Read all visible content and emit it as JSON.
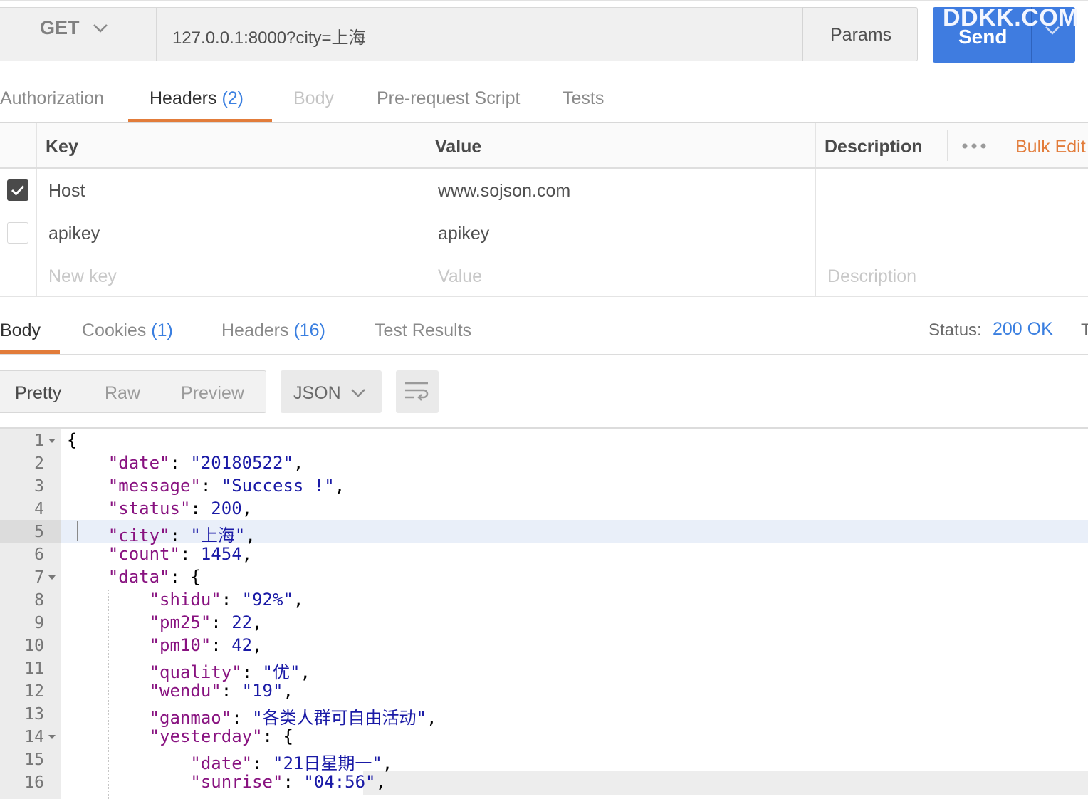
{
  "request": {
    "method": "GET",
    "url": "127.0.0.1:8000?city=上海",
    "params_label": "Params",
    "send_label": "Send",
    "watermark": "DDKK.COM"
  },
  "request_tabs": [
    {
      "label": "Authorization",
      "count": ""
    },
    {
      "label": "Headers",
      "count": "(2)"
    },
    {
      "label": "Body",
      "count": ""
    },
    {
      "label": "Pre-request Script",
      "count": ""
    },
    {
      "label": "Tests",
      "count": ""
    }
  ],
  "headers_table": {
    "columns": {
      "key": "Key",
      "value": "Value",
      "description": "Description"
    },
    "more_icon": "ellipsis-icon",
    "bulk_edit": "Bulk Edit",
    "rows": [
      {
        "checked": true,
        "key": "Host",
        "value": "www.sojson.com",
        "description": ""
      },
      {
        "checked": false,
        "key": "apikey",
        "value": "apikey",
        "description": ""
      }
    ],
    "placeholders": {
      "key": "New key",
      "value": "Value",
      "description": "Description"
    }
  },
  "response_tabs": [
    {
      "label": "Body",
      "count": ""
    },
    {
      "label": "Cookies",
      "count": "(1)"
    },
    {
      "label": "Headers",
      "count": "(16)"
    },
    {
      "label": "Test Results",
      "count": ""
    }
  ],
  "status": {
    "label": "Status:",
    "value": "200 OK",
    "status_color": "#3a7fe0",
    "trailing": "T"
  },
  "view": {
    "modes": [
      "Pretty",
      "Raw",
      "Preview"
    ],
    "active_mode": "Pretty",
    "format": "JSON",
    "wrap_icon": "wrap-lines-icon"
  },
  "code_lines": [
    {
      "n": "1",
      "text": "{"
    },
    {
      "n": "2",
      "text": "    \"date\": \"20180522\","
    },
    {
      "n": "3",
      "text": "    \"message\": \"Success !\","
    },
    {
      "n": "4",
      "text": "    \"status\": 200,"
    },
    {
      "n": "5",
      "text": "    \"city\": \"上海\","
    },
    {
      "n": "6",
      "text": "    \"count\": 1454,"
    },
    {
      "n": "7",
      "text": "    \"data\": {"
    },
    {
      "n": "8",
      "text": "        \"shidu\": \"92%\","
    },
    {
      "n": "9",
      "text": "        \"pm25\": 22,"
    },
    {
      "n": "10",
      "text": "        \"pm10\": 42,"
    },
    {
      "n": "11",
      "text": "        \"quality\": \"优\","
    },
    {
      "n": "12",
      "text": "        \"wendu\": \"19\","
    },
    {
      "n": "13",
      "text": "        \"ganmao\": \"各类人群可自由活动\","
    },
    {
      "n": "14",
      "text": "        \"yesterday\": {"
    },
    {
      "n": "15",
      "text": "            \"date\": \"21日星期一\","
    },
    {
      "n": "16",
      "text": "            \"sunrise\": \"04:56\","
    }
  ],
  "colors": {
    "accent_orange": "#e27c3a",
    "send_blue": "#3f7ce0",
    "json_key": "#881280",
    "json_value": "#1a1aa6"
  }
}
